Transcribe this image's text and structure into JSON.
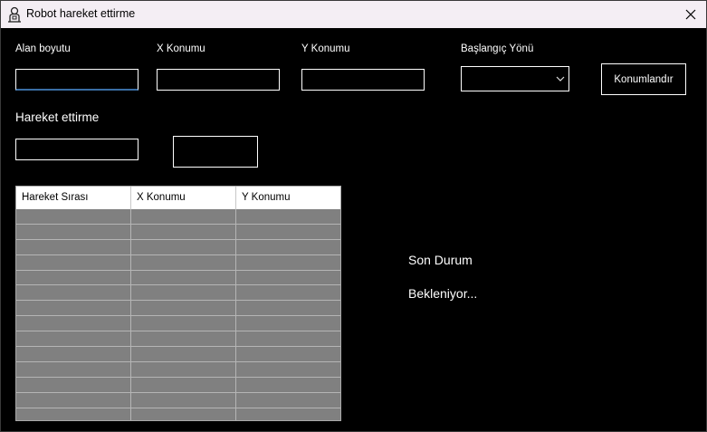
{
  "window": {
    "title": "Robot hareket ettirme"
  },
  "labels": {
    "area_size": "Alan boyutu",
    "x_position": "X Konumu",
    "y_position": "Y Konumu",
    "start_direction": "Başlangıç Yönü",
    "move": "Hareket ettirme"
  },
  "inputs": {
    "area_size": "",
    "x_position": "",
    "y_position": "",
    "start_direction": "",
    "move": ""
  },
  "buttons": {
    "position": "Konumlandır",
    "move": ""
  },
  "table": {
    "columns": [
      "Hareket Sırası",
      "X Konumu",
      "Y Konumu"
    ],
    "rows": []
  },
  "status": {
    "heading": "Son Durum",
    "value": "Bekleniyor..."
  },
  "colors": {
    "background": "#000000",
    "titlebar": "#f4eef4",
    "grid_fill": "#808080",
    "focus_accent": "#3a6ea5"
  },
  "icons": {
    "app": "robot-icon",
    "close": "close-icon",
    "combo_arrow": "chevron-down-icon"
  }
}
